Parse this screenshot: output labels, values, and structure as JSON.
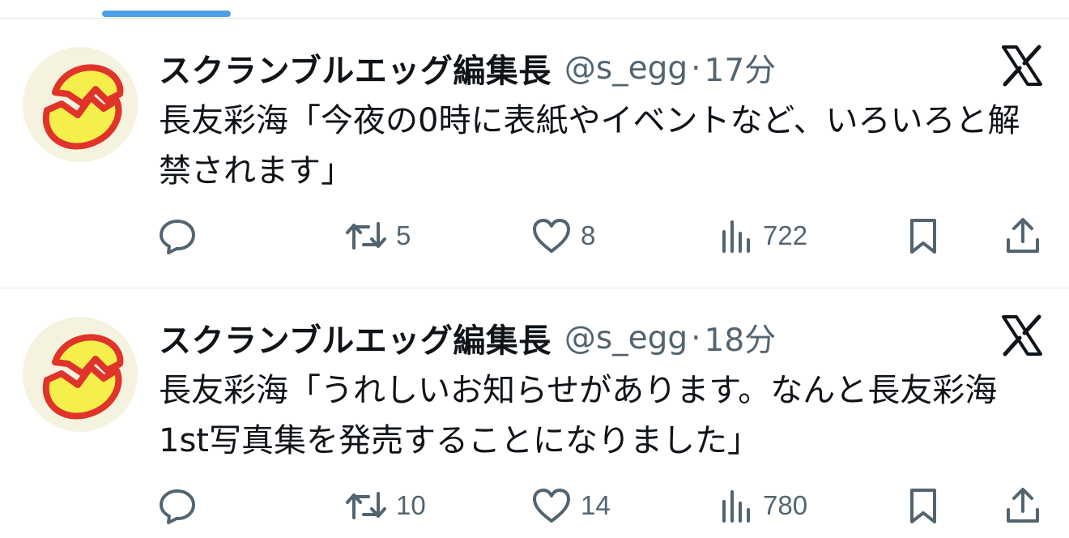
{
  "tweets": [
    {
      "author_name": "スクランブルエッグ編集長",
      "handle": "@s_egg",
      "separator": "·",
      "time": "17分",
      "text": "長友彩海「今夜の0時に表紙やイベントなど、いろいろと解禁されます」",
      "retweets": "5",
      "likes": "8",
      "views": "722"
    },
    {
      "author_name": "スクランブルエッグ編集長",
      "handle": "@s_egg",
      "separator": "·",
      "time": "18分",
      "text": "長友彩海「うれしいお知らせがあります。なんと長友彩海1st写真集を発売することになりました」",
      "retweets": "10",
      "likes": "14",
      "views": "780"
    }
  ],
  "icons": {
    "reply": "reply-icon",
    "retweet": "retweet-icon",
    "like": "heart-icon",
    "views": "views-icon",
    "bookmark": "bookmark-icon",
    "share": "share-icon",
    "platform": "x-logo-icon"
  },
  "colors": {
    "text": "#0f1419",
    "muted": "#536471",
    "accent": "#4e9fe8",
    "divider": "#e3e6e8",
    "avatar_egg": "#f4ef4a",
    "avatar_outline": "#e0332a"
  }
}
